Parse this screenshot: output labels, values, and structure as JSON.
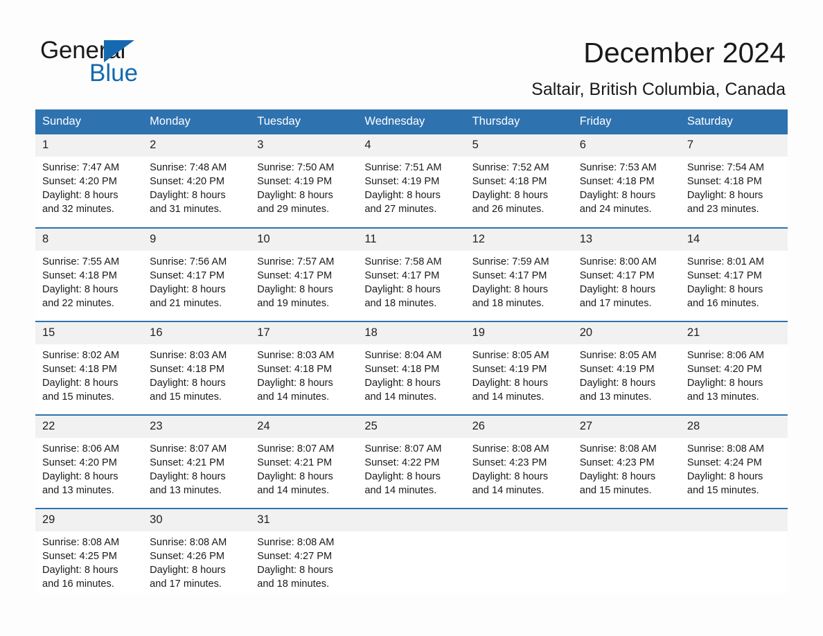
{
  "brand": {
    "name_part1": "General",
    "name_part2": "Blue",
    "triangle_icon": "triangle-icon",
    "accent_color": "#1569b0"
  },
  "header": {
    "title": "December 2024",
    "location": "Saltair, British Columbia, Canada"
  },
  "colors": {
    "header_blue": "#2e72b0",
    "daynum_band": "#f1f1f1",
    "text": "#1a1a1a"
  },
  "calendar": {
    "weekday_headers": [
      "Sunday",
      "Monday",
      "Tuesday",
      "Wednesday",
      "Thursday",
      "Friday",
      "Saturday"
    ],
    "weeks": [
      [
        {
          "day": "1",
          "sunrise": "Sunrise: 7:47 AM",
          "sunset": "Sunset: 4:20 PM",
          "daylight_line1": "Daylight: 8 hours",
          "daylight_line2": "and 32 minutes."
        },
        {
          "day": "2",
          "sunrise": "Sunrise: 7:48 AM",
          "sunset": "Sunset: 4:20 PM",
          "daylight_line1": "Daylight: 8 hours",
          "daylight_line2": "and 31 minutes."
        },
        {
          "day": "3",
          "sunrise": "Sunrise: 7:50 AM",
          "sunset": "Sunset: 4:19 PM",
          "daylight_line1": "Daylight: 8 hours",
          "daylight_line2": "and 29 minutes."
        },
        {
          "day": "4",
          "sunrise": "Sunrise: 7:51 AM",
          "sunset": "Sunset: 4:19 PM",
          "daylight_line1": "Daylight: 8 hours",
          "daylight_line2": "and 27 minutes."
        },
        {
          "day": "5",
          "sunrise": "Sunrise: 7:52 AM",
          "sunset": "Sunset: 4:18 PM",
          "daylight_line1": "Daylight: 8 hours",
          "daylight_line2": "and 26 minutes."
        },
        {
          "day": "6",
          "sunrise": "Sunrise: 7:53 AM",
          "sunset": "Sunset: 4:18 PM",
          "daylight_line1": "Daylight: 8 hours",
          "daylight_line2": "and 24 minutes."
        },
        {
          "day": "7",
          "sunrise": "Sunrise: 7:54 AM",
          "sunset": "Sunset: 4:18 PM",
          "daylight_line1": "Daylight: 8 hours",
          "daylight_line2": "and 23 minutes."
        }
      ],
      [
        {
          "day": "8",
          "sunrise": "Sunrise: 7:55 AM",
          "sunset": "Sunset: 4:18 PM",
          "daylight_line1": "Daylight: 8 hours",
          "daylight_line2": "and 22 minutes."
        },
        {
          "day": "9",
          "sunrise": "Sunrise: 7:56 AM",
          "sunset": "Sunset: 4:17 PM",
          "daylight_line1": "Daylight: 8 hours",
          "daylight_line2": "and 21 minutes."
        },
        {
          "day": "10",
          "sunrise": "Sunrise: 7:57 AM",
          "sunset": "Sunset: 4:17 PM",
          "daylight_line1": "Daylight: 8 hours",
          "daylight_line2": "and 19 minutes."
        },
        {
          "day": "11",
          "sunrise": "Sunrise: 7:58 AM",
          "sunset": "Sunset: 4:17 PM",
          "daylight_line1": "Daylight: 8 hours",
          "daylight_line2": "and 18 minutes."
        },
        {
          "day": "12",
          "sunrise": "Sunrise: 7:59 AM",
          "sunset": "Sunset: 4:17 PM",
          "daylight_line1": "Daylight: 8 hours",
          "daylight_line2": "and 18 minutes."
        },
        {
          "day": "13",
          "sunrise": "Sunrise: 8:00 AM",
          "sunset": "Sunset: 4:17 PM",
          "daylight_line1": "Daylight: 8 hours",
          "daylight_line2": "and 17 minutes."
        },
        {
          "day": "14",
          "sunrise": "Sunrise: 8:01 AM",
          "sunset": "Sunset: 4:17 PM",
          "daylight_line1": "Daylight: 8 hours",
          "daylight_line2": "and 16 minutes."
        }
      ],
      [
        {
          "day": "15",
          "sunrise": "Sunrise: 8:02 AM",
          "sunset": "Sunset: 4:18 PM",
          "daylight_line1": "Daylight: 8 hours",
          "daylight_line2": "and 15 minutes."
        },
        {
          "day": "16",
          "sunrise": "Sunrise: 8:03 AM",
          "sunset": "Sunset: 4:18 PM",
          "daylight_line1": "Daylight: 8 hours",
          "daylight_line2": "and 15 minutes."
        },
        {
          "day": "17",
          "sunrise": "Sunrise: 8:03 AM",
          "sunset": "Sunset: 4:18 PM",
          "daylight_line1": "Daylight: 8 hours",
          "daylight_line2": "and 14 minutes."
        },
        {
          "day": "18",
          "sunrise": "Sunrise: 8:04 AM",
          "sunset": "Sunset: 4:18 PM",
          "daylight_line1": "Daylight: 8 hours",
          "daylight_line2": "and 14 minutes."
        },
        {
          "day": "19",
          "sunrise": "Sunrise: 8:05 AM",
          "sunset": "Sunset: 4:19 PM",
          "daylight_line1": "Daylight: 8 hours",
          "daylight_line2": "and 14 minutes."
        },
        {
          "day": "20",
          "sunrise": "Sunrise: 8:05 AM",
          "sunset": "Sunset: 4:19 PM",
          "daylight_line1": "Daylight: 8 hours",
          "daylight_line2": "and 13 minutes."
        },
        {
          "day": "21",
          "sunrise": "Sunrise: 8:06 AM",
          "sunset": "Sunset: 4:20 PM",
          "daylight_line1": "Daylight: 8 hours",
          "daylight_line2": "and 13 minutes."
        }
      ],
      [
        {
          "day": "22",
          "sunrise": "Sunrise: 8:06 AM",
          "sunset": "Sunset: 4:20 PM",
          "daylight_line1": "Daylight: 8 hours",
          "daylight_line2": "and 13 minutes."
        },
        {
          "day": "23",
          "sunrise": "Sunrise: 8:07 AM",
          "sunset": "Sunset: 4:21 PM",
          "daylight_line1": "Daylight: 8 hours",
          "daylight_line2": "and 13 minutes."
        },
        {
          "day": "24",
          "sunrise": "Sunrise: 8:07 AM",
          "sunset": "Sunset: 4:21 PM",
          "daylight_line1": "Daylight: 8 hours",
          "daylight_line2": "and 14 minutes."
        },
        {
          "day": "25",
          "sunrise": "Sunrise: 8:07 AM",
          "sunset": "Sunset: 4:22 PM",
          "daylight_line1": "Daylight: 8 hours",
          "daylight_line2": "and 14 minutes."
        },
        {
          "day": "26",
          "sunrise": "Sunrise: 8:08 AM",
          "sunset": "Sunset: 4:23 PM",
          "daylight_line1": "Daylight: 8 hours",
          "daylight_line2": "and 14 minutes."
        },
        {
          "day": "27",
          "sunrise": "Sunrise: 8:08 AM",
          "sunset": "Sunset: 4:23 PM",
          "daylight_line1": "Daylight: 8 hours",
          "daylight_line2": "and 15 minutes."
        },
        {
          "day": "28",
          "sunrise": "Sunrise: 8:08 AM",
          "sunset": "Sunset: 4:24 PM",
          "daylight_line1": "Daylight: 8 hours",
          "daylight_line2": "and 15 minutes."
        }
      ],
      [
        {
          "day": "29",
          "sunrise": "Sunrise: 8:08 AM",
          "sunset": "Sunset: 4:25 PM",
          "daylight_line1": "Daylight: 8 hours",
          "daylight_line2": "and 16 minutes."
        },
        {
          "day": "30",
          "sunrise": "Sunrise: 8:08 AM",
          "sunset": "Sunset: 4:26 PM",
          "daylight_line1": "Daylight: 8 hours",
          "daylight_line2": "and 17 minutes."
        },
        {
          "day": "31",
          "sunrise": "Sunrise: 8:08 AM",
          "sunset": "Sunset: 4:27 PM",
          "daylight_line1": "Daylight: 8 hours",
          "daylight_line2": "and 18 minutes."
        },
        {
          "day": "",
          "sunrise": "",
          "sunset": "",
          "daylight_line1": "",
          "daylight_line2": ""
        },
        {
          "day": "",
          "sunrise": "",
          "sunset": "",
          "daylight_line1": "",
          "daylight_line2": ""
        },
        {
          "day": "",
          "sunrise": "",
          "sunset": "",
          "daylight_line1": "",
          "daylight_line2": ""
        },
        {
          "day": "",
          "sunrise": "",
          "sunset": "",
          "daylight_line1": "",
          "daylight_line2": ""
        }
      ]
    ]
  }
}
